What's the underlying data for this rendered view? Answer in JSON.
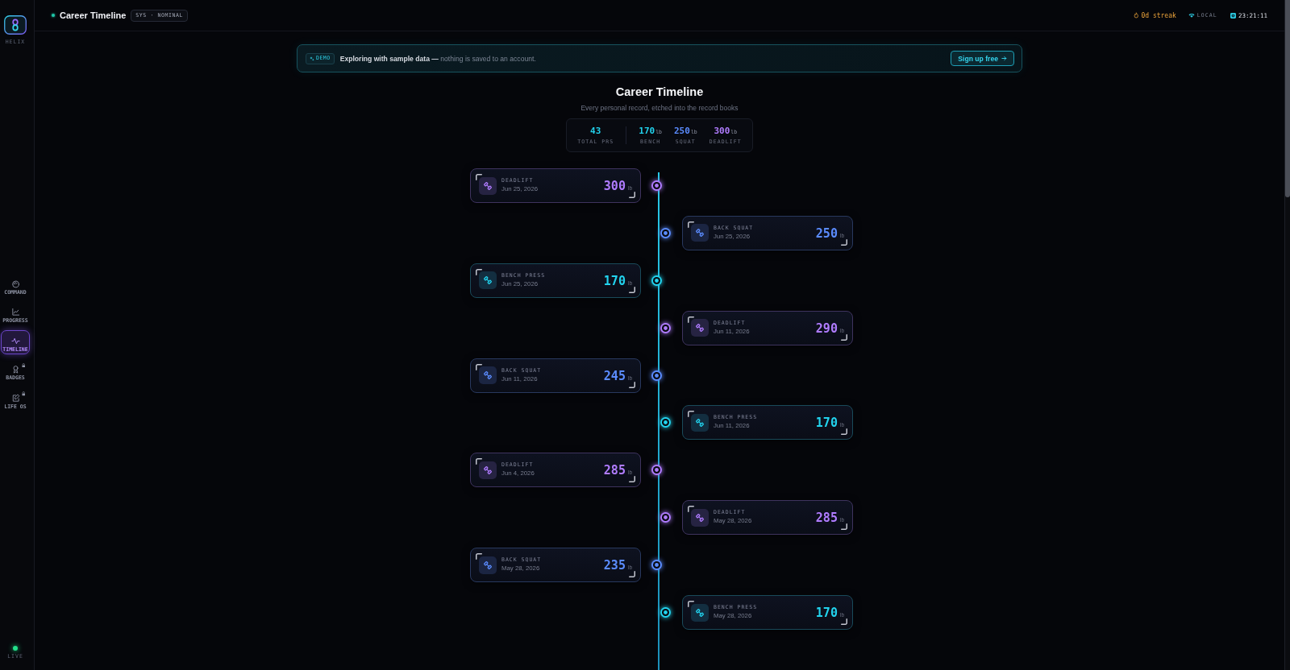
{
  "sidebar": {
    "logo_label": "HELIX",
    "items": [
      {
        "label": "COMMAND",
        "selected": false,
        "locked": false
      },
      {
        "label": "PROGRESS",
        "selected": false,
        "locked": false
      },
      {
        "label": "TIMELINE",
        "selected": true,
        "locked": false
      },
      {
        "label": "BADGES",
        "selected": false,
        "locked": true
      },
      {
        "label": "LIFE OS",
        "selected": false,
        "locked": true
      }
    ],
    "status_label": "LIVE"
  },
  "header": {
    "title": "Career Timeline",
    "status_badge": "SYS · NOMINAL",
    "streak": "0d streak",
    "connection": "LOCAL",
    "clock": "23:21:11"
  },
  "banner": {
    "badge": "DEMO",
    "message": "**Exploring with sample data —** nothing is saved to an account.",
    "button": "Sign up free"
  },
  "page": {
    "title": "Career Timeline",
    "subtitle": "Every personal record, etched into the record books"
  },
  "stats": [
    {
      "value": "43",
      "label": "TOTAL PRS",
      "color": "#22d3ee"
    },
    {
      "value": "170",
      "unit": "lb",
      "label": "BENCH",
      "color": "#22d3ee"
    },
    {
      "value": "250",
      "unit": "lb",
      "label": "SQUAT",
      "color": "#5b8cff"
    },
    {
      "value": "300",
      "unit": "lb",
      "label": "DEADLIFT",
      "color": "#b07cff"
    }
  ],
  "records": [
    {
      "lift": "DEADLIFT",
      "date": "Jun 25, 2026",
      "value": "300",
      "unit": "lb",
      "color": "#b07cff"
    },
    {
      "lift": "BACK SQUAT",
      "date": "Jun 25, 2026",
      "value": "250",
      "unit": "lb",
      "color": "#5b8cff"
    },
    {
      "lift": "BENCH PRESS",
      "date": "Jun 25, 2026",
      "value": "170",
      "unit": "lb",
      "color": "#22d3ee"
    },
    {
      "lift": "DEADLIFT",
      "date": "Jun 11, 2026",
      "value": "290",
      "unit": "lb",
      "color": "#b07cff"
    },
    {
      "lift": "BACK SQUAT",
      "date": "Jun 11, 2026",
      "value": "245",
      "unit": "lb",
      "color": "#5b8cff"
    },
    {
      "lift": "BENCH PRESS",
      "date": "Jun 11, 2026",
      "value": "170",
      "unit": "lb",
      "color": "#22d3ee"
    },
    {
      "lift": "DEADLIFT",
      "date": "Jun 4, 2026",
      "value": "285",
      "unit": "lb",
      "color": "#b07cff"
    },
    {
      "lift": "DEADLIFT",
      "date": "May 28, 2026",
      "value": "285",
      "unit": "lb",
      "color": "#b07cff"
    },
    {
      "lift": "BACK SQUAT",
      "date": "May 28, 2026",
      "value": "235",
      "unit": "lb",
      "color": "#5b8cff"
    },
    {
      "lift": "BENCH PRESS",
      "date": "May 28, 2026",
      "value": "170",
      "unit": "lb",
      "color": "#22d3ee"
    }
  ]
}
